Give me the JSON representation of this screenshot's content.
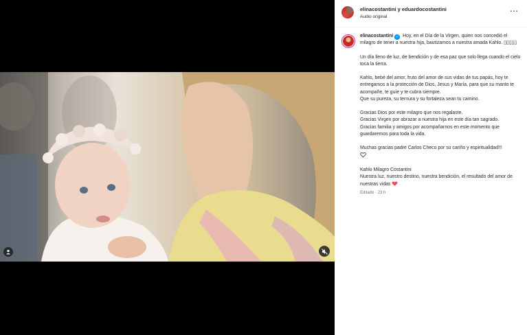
{
  "header": {
    "usernames": "elinacostantini y eduardocostantini",
    "audio": "Audio original",
    "more_icon": "⋯"
  },
  "caption": {
    "username": "elinacostantini",
    "intro_line": "Hoy, en el Día de la Virgen, quien nos concedió el milagro de tener a nuestra hija, bautizamos a nuestra amada Kahlo. ",
    "intro_emoji": "▯▯▯▯▯",
    "p2": "Un día lleno de luz, de bendición y de esa paz que solo llega cuando el cielo toca la tierra.",
    "p3_a": "Kahlo, bebé del amor, fruto del amor de sus vidas de tus papás, hoy te entregamos a la protección de Dios, Jesus y María, para que su manto te acompañe, te guíe y te cubra siempre.",
    "p3_b": "Que su pureza, su ternura y su fortaleza sean tu camino.",
    "p4_a": "Gracias Dios por este milagro que nos regalaste.",
    "p4_b": "Gracias Virgen por abrazar a nuestra hija en este día tan sagrado.",
    "p4_c": "Gracias familia y amigos por acompañarnos en este momento que guardaremos para toda la vida.",
    "p5": "Muchas gracias padre Carlos Checo por su cariño y espiritualidad!!!",
    "p6_a": "Kahlo Milagro Costantini",
    "p6_b": "Nuestra luz, nuestro destino, nuestra bendición, el resultado del amor de nuestras vidas ",
    "edited": "Editado · 23 h"
  },
  "colors": {
    "verified": "#0095f6",
    "heart": "#ed4956",
    "text": "#262626",
    "muted": "#737373"
  },
  "icons": {
    "tag": "user-tag-icon",
    "mute": "audio-muted-icon",
    "heart_outline": "heart-outline-icon",
    "heart_red": "red-heart-icon",
    "verified": "verified-badge-icon"
  }
}
